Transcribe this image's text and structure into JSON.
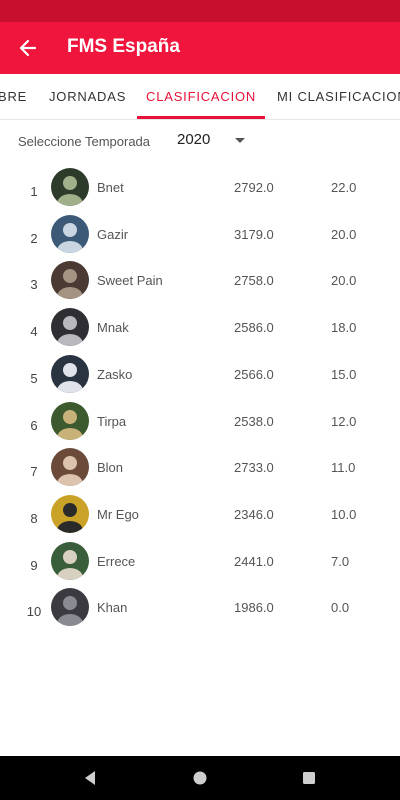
{
  "app_bar": {
    "title": "FMS España",
    "back_icon": "arrow-left-icon"
  },
  "tabs": [
    {
      "label": "BRE"
    },
    {
      "label": "JORNADAS"
    },
    {
      "label": "CLASIFICACION",
      "active": true
    },
    {
      "label": "MI CLASIFICACION"
    }
  ],
  "season": {
    "label": "Seleccione Temporada",
    "value": "2020"
  },
  "standings": [
    {
      "rank": "1",
      "name": "Bnet",
      "points": "2792.0",
      "score": "22.0"
    },
    {
      "rank": "2",
      "name": "Gazir",
      "points": "3179.0",
      "score": "20.0"
    },
    {
      "rank": "3",
      "name": "Sweet Pain",
      "points": "2758.0",
      "score": "20.0"
    },
    {
      "rank": "4",
      "name": "Mnak",
      "points": "2586.0",
      "score": "18.0"
    },
    {
      "rank": "5",
      "name": "Zasko",
      "points": "2566.0",
      "score": "15.0"
    },
    {
      "rank": "6",
      "name": "Tirpa",
      "points": "2538.0",
      "score": "12.0"
    },
    {
      "rank": "7",
      "name": "Blon",
      "points": "2733.0",
      "score": "11.0"
    },
    {
      "rank": "8",
      "name": "Mr Ego",
      "points": "2346.0",
      "score": "10.0"
    },
    {
      "rank": "9",
      "name": "Errece",
      "points": "2441.0",
      "score": "7.0"
    },
    {
      "rank": "10",
      "name": "Khan",
      "points": "1986.0",
      "score": "0.0"
    }
  ],
  "colors": {
    "primary": "#f0153c",
    "status_bar": "#c8102e",
    "accent": "#e8113a"
  },
  "nav": {
    "back": "triangle-back-icon",
    "home": "circle-home-icon",
    "recents": "square-recents-icon"
  }
}
